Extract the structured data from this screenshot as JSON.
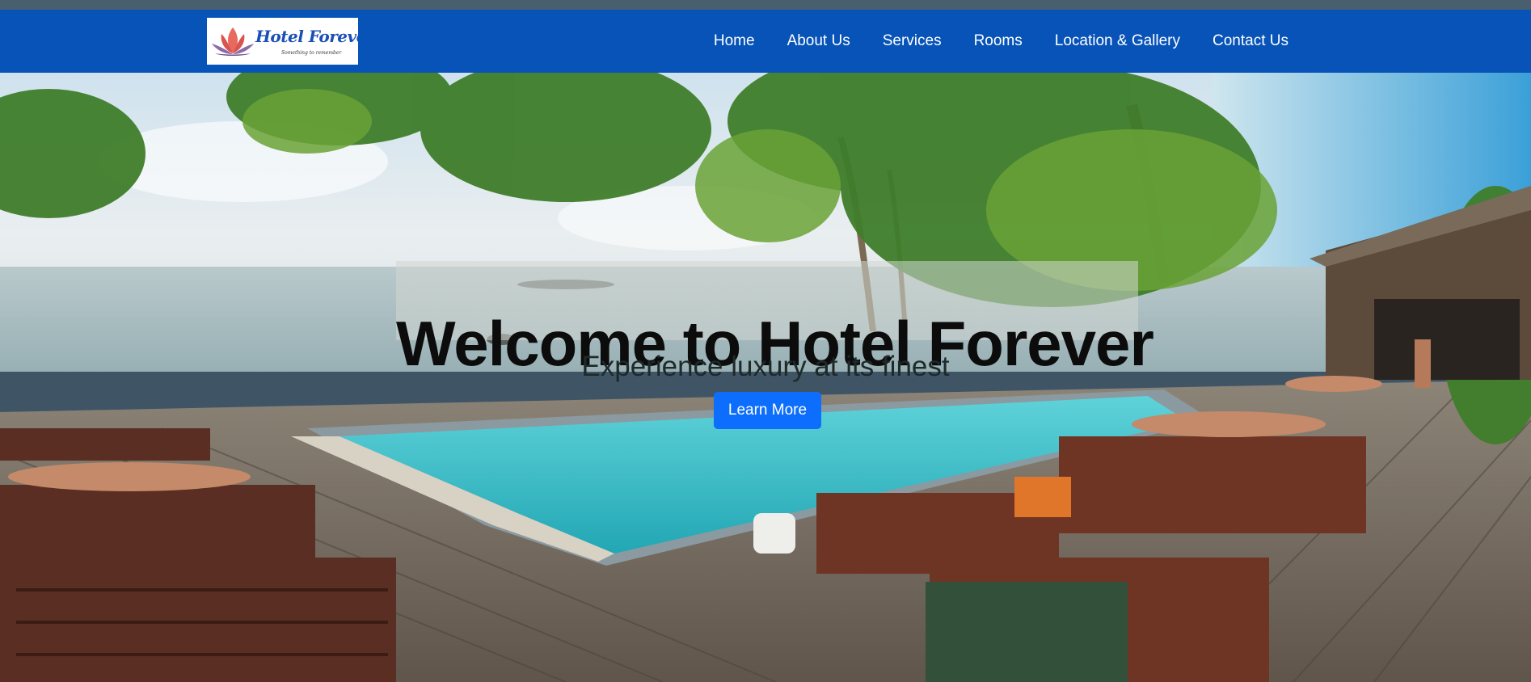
{
  "brand": {
    "name": "Hotel Forever",
    "tagline": "Something to remember",
    "colors": {
      "navbar": "#0753b8",
      "button": "#0d6efd",
      "logo_text": "#1a4fb5"
    }
  },
  "nav": {
    "items": [
      {
        "label": "Home"
      },
      {
        "label": "About Us"
      },
      {
        "label": "Services"
      },
      {
        "label": "Rooms"
      },
      {
        "label": "Location & Gallery"
      },
      {
        "label": "Contact Us"
      }
    ]
  },
  "hero": {
    "title": "Welcome to Hotel Forever",
    "subtitle": "Experience luxury at its finest",
    "cta_label": "Learn More",
    "image_icon": "resort-pool-photo"
  }
}
